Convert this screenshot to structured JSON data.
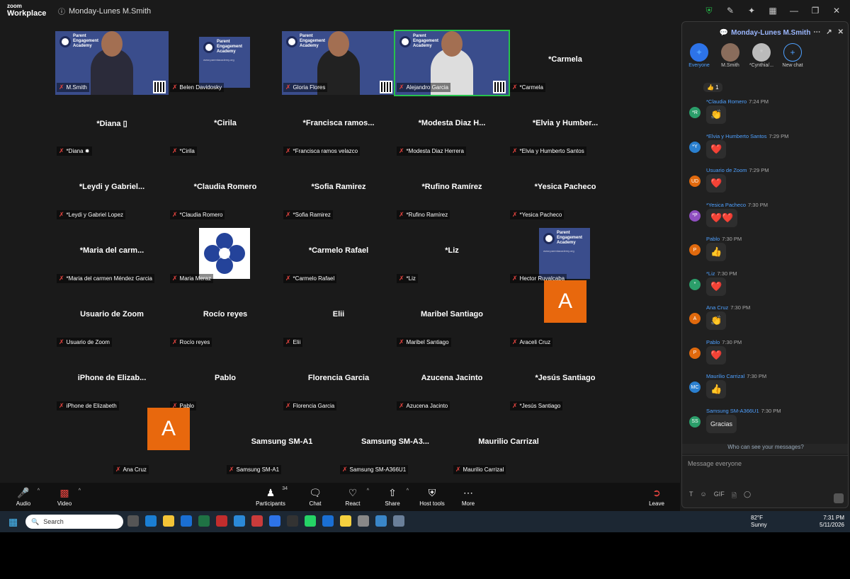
{
  "titlebar": {
    "logo_line1": "zoom",
    "logo_line2": "Workplace",
    "meeting_title": "Monday-Lunes M.Smith"
  },
  "tiles": [
    {
      "type": "video",
      "big": "",
      "label": "M.Smith"
    },
    {
      "type": "logo",
      "big": "",
      "label": "Belen Davidosky"
    },
    {
      "type": "video",
      "big": "",
      "label": "Gloria Flores"
    },
    {
      "type": "video",
      "big": "",
      "label": "Alejandro Garcia"
    },
    {
      "type": "name",
      "big": "*Carmela",
      "label": "*Carmela"
    },
    {
      "type": "name",
      "big": "*Diana ▯",
      "label": "*Diana ✹"
    },
    {
      "type": "name",
      "big": "*Cirila",
      "label": "*Cirila"
    },
    {
      "type": "name",
      "big": "*Francisca  ramos...",
      "label": "*Francisca ramos velazco"
    },
    {
      "type": "name",
      "big": "*Modesta Diaz H...",
      "label": "*Modesta Diaz Herrera"
    },
    {
      "type": "name",
      "big": "*Elvia  y  Humber...",
      "label": "*Elvia y Humberto Santos"
    },
    {
      "type": "name",
      "big": "*Leydi y Gabriel...",
      "label": "*Leydi y Gabriel Lopez"
    },
    {
      "type": "name",
      "big": "*Claudia Romero",
      "label": "*Claudia Romero"
    },
    {
      "type": "name",
      "big": "*Sofia Ramirez",
      "label": "*Sofia Ramirez"
    },
    {
      "type": "name",
      "big": "*Rufino Ramírez",
      "label": "*Rufino Ramírez"
    },
    {
      "type": "name",
      "big": "*Yesica Pacheco",
      "label": "*Yesica Pacheco"
    },
    {
      "type": "name",
      "big": "*Maria del carm...",
      "label": "*Maria del carmen Méndez Garcia"
    },
    {
      "type": "flower",
      "big": "",
      "label": "Maria Meraz"
    },
    {
      "type": "name",
      "big": "*Carmelo Rafael",
      "label": "*Carmelo Rafael"
    },
    {
      "type": "name",
      "big": "*Liz",
      "label": "*Liz"
    },
    {
      "type": "logo",
      "big": "",
      "label": "Hector Ruvalcaba"
    },
    {
      "type": "name",
      "big": "Usuario de Zoom",
      "label": "Usuario de Zoom"
    },
    {
      "type": "name",
      "big": "Rocío reyes",
      "label": "Rocío reyes"
    },
    {
      "type": "name",
      "big": "Elii",
      "label": "Elii"
    },
    {
      "type": "name",
      "big": "Maribel Santiago",
      "label": "Maribel Santiago"
    },
    {
      "type": "avatar",
      "big": "A",
      "label": "Araceli Cruz"
    },
    {
      "type": "name",
      "big": "iPhone de Elizab...",
      "label": "iPhone de Elizabeth"
    },
    {
      "type": "name",
      "big": "Pablo",
      "label": "Pablo"
    },
    {
      "type": "name",
      "big": "Florencia Garcia",
      "label": "Florencia Garcia"
    },
    {
      "type": "name",
      "big": "Azucena Jacinto",
      "label": "Azucena Jacinto"
    },
    {
      "type": "name",
      "big": "*Jesús Santiago",
      "label": "*Jesús Santiago"
    },
    {
      "type": "avatar",
      "big": "A",
      "label": "Ana Cruz"
    },
    {
      "type": "name",
      "big": "Samsung SM-A1",
      "label": "Samsung SM-A1"
    },
    {
      "type": "name",
      "big": "Samsung  SM-A3...",
      "label": "Samsung SM-A366U1"
    },
    {
      "type": "name",
      "big": "Maurilio Carrizal",
      "label": "Maurilio Carrizal"
    }
  ],
  "brand": {
    "line1": "Parent",
    "line2": "Engagement",
    "line3": "Academy",
    "url": "www.parentacademy.org"
  },
  "chat": {
    "title": "Monday-Lunes M.Smith",
    "recipients": [
      {
        "name": "Everyone",
        "initial": "✦"
      },
      {
        "name": "M.Smith",
        "initial": ""
      },
      {
        "name": "*Cynthia/...",
        "initial": "*"
      },
      {
        "name": "New chat",
        "initial": "+"
      }
    ],
    "top_reaction": "👍 1",
    "messages": [
      {
        "initials": "*R",
        "color": "#2b9e6a",
        "name": "*Claudia Romero",
        "time": "7:24 PM",
        "content": "👏"
      },
      {
        "initials": "*Y",
        "color": "#2a7fcf",
        "name": "*Elvia y Humberto Santos",
        "time": "7:29 PM",
        "content": "❤️"
      },
      {
        "initials": "UD",
        "color": "#e0690d",
        "name": "Usuario de Zoom",
        "time": "7:29 PM",
        "content": "❤️"
      },
      {
        "initials": "*P",
        "color": "#8f4fc0",
        "name": "*Yesica Pacheco",
        "time": "7:30 PM",
        "content": "❤️❤️"
      },
      {
        "initials": "P",
        "color": "#e0690d",
        "name": "Pablo",
        "time": "7:30 PM",
        "content": "👍"
      },
      {
        "initials": "*",
        "color": "#2b9e6a",
        "name": "*Liz",
        "time": "7:30 PM",
        "content": "❤️"
      },
      {
        "initials": "A",
        "color": "#e0690d",
        "name": "Ana Cruz",
        "time": "7:30 PM",
        "content": "👏"
      },
      {
        "initials": "P",
        "color": "#e0690d",
        "name": "Pablo",
        "time": "7:30 PM",
        "content": "❤️"
      },
      {
        "initials": "MC",
        "color": "#2a7fcf",
        "name": "Maurilio Carrizal",
        "time": "7:30 PM",
        "content": "👍"
      },
      {
        "initials": "SS",
        "color": "#2b9e6a",
        "name": "Samsung SM-A366U1",
        "time": "7:30 PM",
        "content": "Gracias"
      }
    ],
    "who_can": "Who can see your messages?",
    "placeholder": "Message everyone"
  },
  "toolbar": {
    "audio": "Audio",
    "video": "Video",
    "participants": "Participants",
    "participants_count": "34",
    "chat": "Chat",
    "react": "React",
    "share": "Share",
    "host_tools": "Host tools",
    "more": "More",
    "leave": "Leave"
  },
  "taskbar": {
    "search": "Search",
    "temp": "82°F",
    "weather": "Sunny",
    "time": "7:31 PM",
    "date": "5/11/2026"
  }
}
